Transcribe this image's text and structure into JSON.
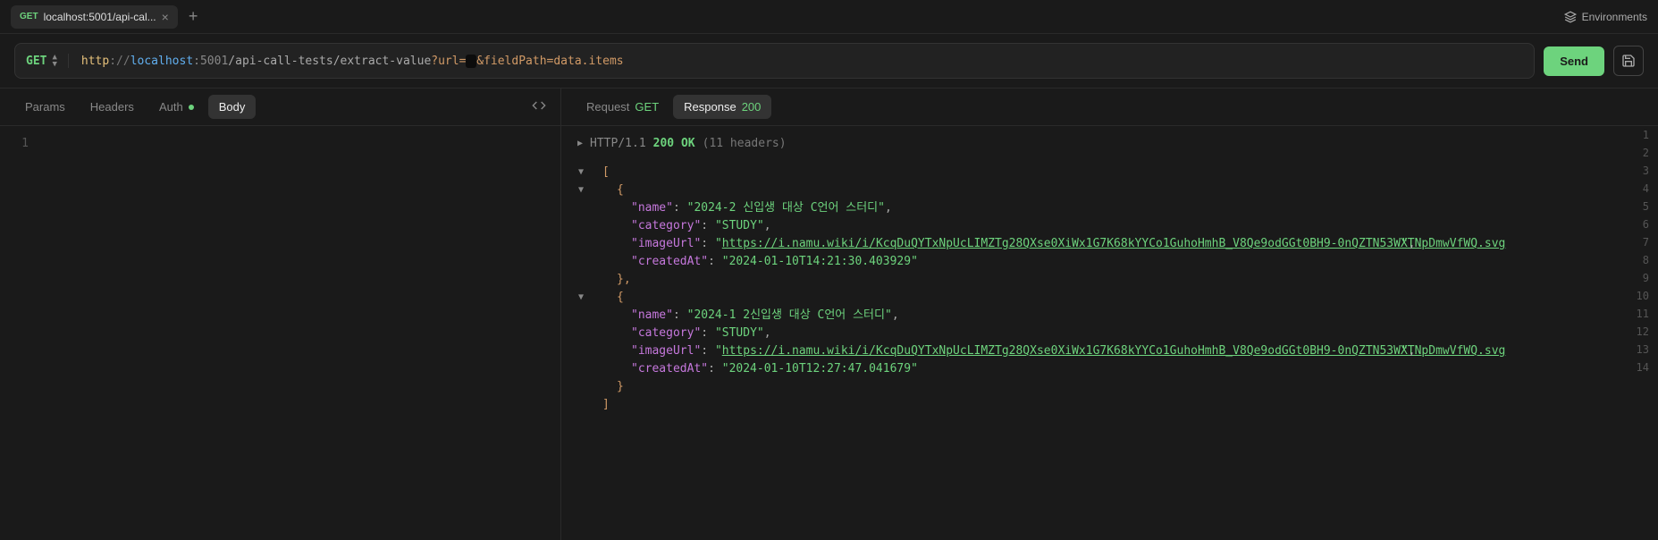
{
  "topbar": {
    "tab_method": "GET",
    "tab_title": "localhost:5001/api-cal...",
    "environments_label": "Environments"
  },
  "urlbar": {
    "method": "GET",
    "scheme": "http",
    "sep": "://",
    "host": "localhost",
    "port": ":5001",
    "path": "/api-call-tests/extract-value",
    "q_start": "?url=",
    "redacted": "                                                                              ",
    "q_tail": "&fieldPath=data.items",
    "send_label": "Send"
  },
  "left_tabs": {
    "params": "Params",
    "headers": "Headers",
    "auth": "Auth",
    "body": "Body"
  },
  "left_editor": {
    "line_number": "1"
  },
  "right_tabs": {
    "request_label": "Request",
    "request_method": "GET",
    "response_label": "Response",
    "response_status": "200"
  },
  "status_line": {
    "proto": "HTTP/1.1",
    "code": "200",
    "ok": "OK",
    "headers_count": "(11 headers)"
  },
  "json": {
    "open": "[",
    "obj_open": "{",
    "k_name": "\"name\"",
    "v_name1": "\"2024-2 신입생 대상 C언어 스터디\"",
    "k_category": "\"category\"",
    "v_category": "\"STUDY\"",
    "k_imageUrl": "\"imageUrl\"",
    "v_imageUrl_q": "\"",
    "v_imageUrl_link1": "https://i.namu.wiki/i/KcqDuQYTxNpUcLIMZTg28QXse0XiWx1G7K68kYYCo1GuhoHmhB_V8Qe9odGGt0BH9-0nQZTN53WXTNpDmwVfWQ.svg",
    "k_createdAt": "\"createdAt\"",
    "v_createdAt1": "\"2024-01-10T14:21:30.403929\"",
    "obj_close_c": "},",
    "v_name2": "\"2024-1 2신입생 대상 C언어 스터디\"",
    "v_imageUrl_link2": "https://i.namu.wiki/i/KcqDuQYTxNpUcLIMZTg28QXse0XiWx1G7K68kYYCo1GuhoHmhB_V8Qe9odGGt0BH9-0nQZTN53WXTNpDmwVfWQ.svg",
    "v_createdAt2": "\"2024-01-10T12:27:47.041679\"",
    "obj_close": "}",
    "close": "]"
  },
  "line_numbers": [
    "1",
    "2",
    "3",
    "4",
    "5",
    "6",
    "7",
    "8",
    "9",
    "10",
    "11",
    "12",
    "13",
    "14"
  ]
}
